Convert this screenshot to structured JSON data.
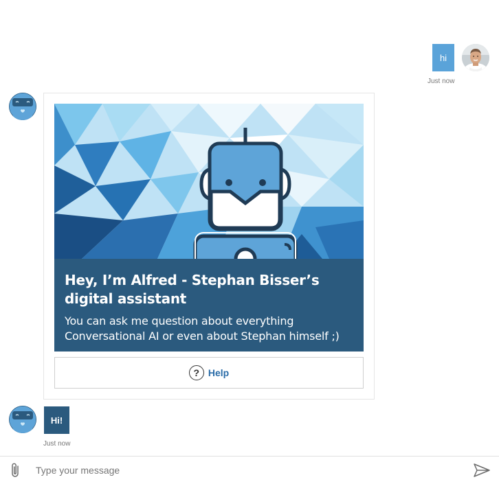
{
  "user": {
    "message": "hi",
    "timestamp": "Just now",
    "avatar_icon": "user-photo-avatar"
  },
  "bot": {
    "avatar_icon": "robot-avatar-icon",
    "card": {
      "title": "Hey, I’m Alfred - Stephan Bisser’s digital assistant",
      "text": "You can ask me question about everything Conversational AI or even about Stephan himself ;)",
      "button_label": "Help",
      "button_icon": "question-circle-icon"
    },
    "reply": "Hi!",
    "reply_timestamp": "Just now"
  },
  "input": {
    "placeholder": "Type your message",
    "value": "",
    "attach_icon": "paperclip-icon",
    "send_icon": "send-icon"
  },
  "colors": {
    "user_bubble": "#5aa3d9",
    "bot_bubble": "#2b5a7e",
    "link": "#2a6ca8"
  }
}
